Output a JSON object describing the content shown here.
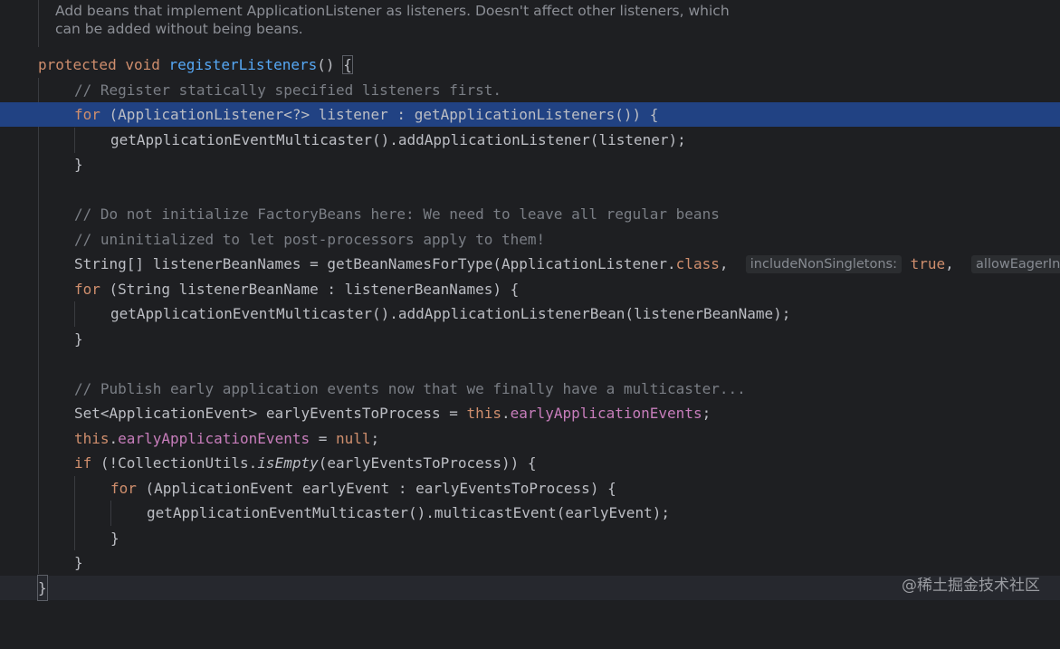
{
  "doc_comment": {
    "line1": "Add beans that implement ApplicationListener as listeners. Doesn't affect other listeners, which",
    "line2": "can be added without being beans."
  },
  "code": {
    "l_sig": {
      "kw1": "protected",
      "kw2": "void",
      "name": "registerListeners",
      "rest": "() ",
      "brace": "{"
    },
    "l_c1": "// Register statically specified listeners first.",
    "l_for1": {
      "kw": "for",
      "rest": " (ApplicationListener<?> listener : getApplicationListeners()) {"
    },
    "l_add1": "getApplicationEventMulticaster().addApplicationListener(listener);",
    "l_close1": "}",
    "l_c2": "// Do not initialize FactoryBeans here: We need to leave all regular beans",
    "l_c3": "// uninitialized to let post-processors apply to them!",
    "l_names": {
      "pre": "String[] listenerBeanNames = getBeanNamesForType(ApplicationListener.",
      "cls": "class",
      "comma": ", ",
      "hint1": "includeNonSingletons:",
      "val1": "true",
      "comma2": ", ",
      "hint2": "allowEagerInit:"
    },
    "l_for2": {
      "kw": "for",
      "rest": " (String listenerBeanName : listenerBeanNames) {"
    },
    "l_add2": "getApplicationEventMulticaster().addApplicationListenerBean(listenerBeanName);",
    "l_close2": "}",
    "l_c4": "// Publish early application events now that we finally have a multicaster...",
    "l_set": {
      "pre": "Set<ApplicationEvent> earlyEventsToProcess = ",
      "this": "this",
      "dot": ".",
      "field": "earlyApplicationEvents",
      "end": ";"
    },
    "l_null": {
      "this": "this",
      "dot": ".",
      "field": "earlyApplicationEvents",
      "mid": " = ",
      "null": "null",
      "end": ";"
    },
    "l_if": {
      "kw": "if",
      "pre": " (!CollectionUtils.",
      "method": "isEmpty",
      "rest": "(earlyEventsToProcess)) {"
    },
    "l_for3": {
      "kw": "for",
      "rest": " (ApplicationEvent earlyEvent : earlyEventsToProcess) {"
    },
    "l_multi": "getApplicationEventMulticaster().multicastEvent(earlyEvent);",
    "l_close3": "}",
    "l_close4": "}",
    "l_close5": "}"
  },
  "watermark": "@稀土掘金技术社区"
}
